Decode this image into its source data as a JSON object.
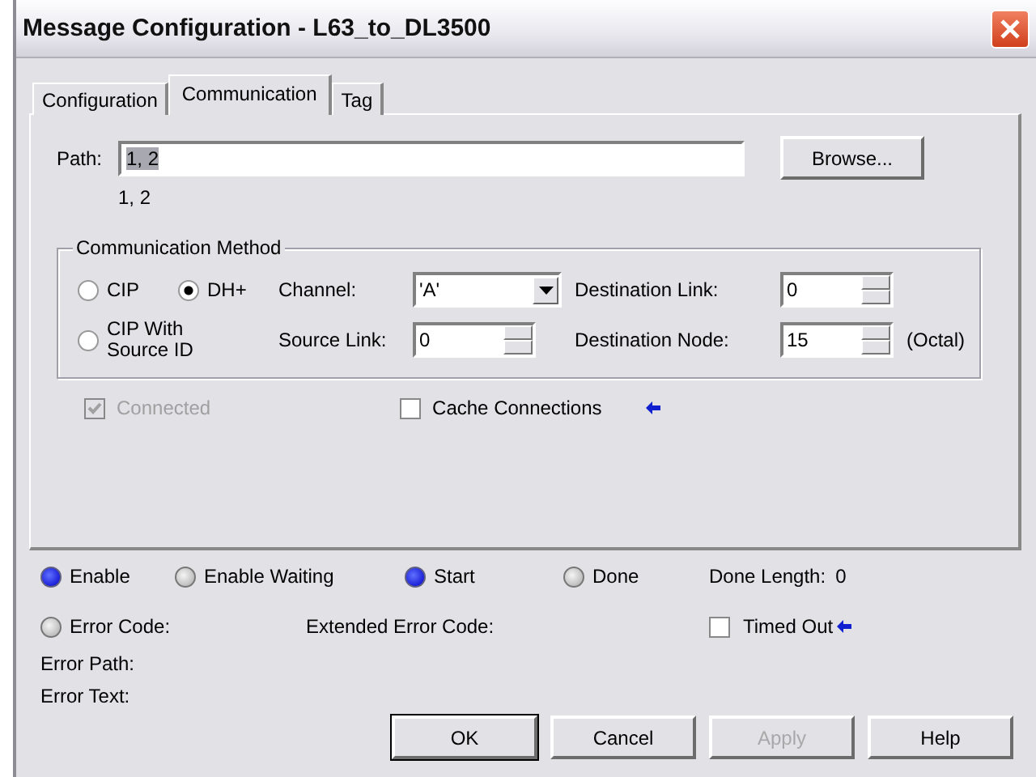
{
  "window": {
    "title": "Message Configuration - L63_to_DL3500"
  },
  "tabs": [
    {
      "label": "Configuration",
      "selected": false
    },
    {
      "label": "Communication",
      "selected": true
    },
    {
      "label": "Tag",
      "selected": false
    }
  ],
  "path": {
    "label": "Path:",
    "value": "1, 2",
    "highlighted": true,
    "resolved": "1, 2",
    "button": "Browse..."
  },
  "communication_method": {
    "title": "Communication Method",
    "options": [
      {
        "label": "CIP",
        "selected": false
      },
      {
        "label": "DH+",
        "selected": true
      },
      {
        "label": "CIP With Source ID",
        "selected": false
      }
    ],
    "channel": {
      "label": "Channel:",
      "value": "'A'"
    },
    "source_link": {
      "label": "Source Link:",
      "value": "0"
    },
    "destination_link": {
      "label": "Destination Link:",
      "value": "0"
    },
    "destination_node": {
      "label": "Destination Node:",
      "value": "15",
      "unit": "(Octal)"
    }
  },
  "connected": {
    "label": "Connected",
    "checked": true,
    "disabled": true
  },
  "cache_connections": {
    "label": "Cache Connections",
    "checked": false,
    "disabled": false
  },
  "status": [
    {
      "label": "Enable",
      "on": true
    },
    {
      "label": "Enable Waiting",
      "on": false
    },
    {
      "label": "Start",
      "on": true
    },
    {
      "label": "Done",
      "on": false
    }
  ],
  "done_length": {
    "label": "Done Length:",
    "value": "0"
  },
  "error_code": {
    "label": "Error Code:",
    "on": false
  },
  "extended_error_code": {
    "label": "Extended Error Code:"
  },
  "timed_out": {
    "label": "Timed Out",
    "checked": false
  },
  "error_path": {
    "label": "Error Path:"
  },
  "error_text": {
    "label": "Error Text:"
  },
  "buttons": [
    {
      "label": "OK",
      "disabled": false,
      "default": true
    },
    {
      "label": "Cancel",
      "disabled": false,
      "default": false
    },
    {
      "label": "Apply",
      "disabled": true,
      "default": false
    },
    {
      "label": "Help",
      "disabled": false,
      "default": false
    }
  ]
}
